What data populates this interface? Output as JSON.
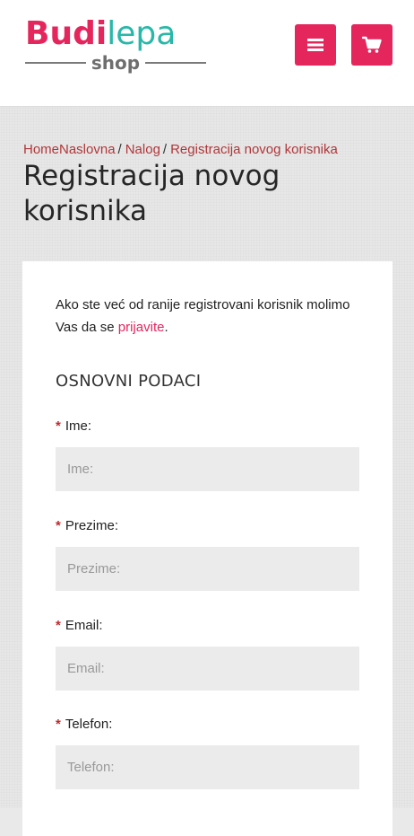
{
  "header": {
    "logo": {
      "part1": "Budi",
      "part2": "lepa",
      "sub": "shop"
    },
    "icons": {
      "menu": "hamburger-menu-icon",
      "cart": "shopping-cart-icon"
    },
    "colors": {
      "brand_pink": "#e5265d",
      "brand_teal": "#27b8a8",
      "logo_gray": "#6e6e6e"
    }
  },
  "breadcrumb": {
    "items": [
      "HomeNaslovna",
      "Nalog",
      "Registracija novog korisnika"
    ],
    "separator": "/"
  },
  "page": {
    "title": "Registracija novog korisnika"
  },
  "form": {
    "intro_text": "Ako ste već od ranije registrovani korisnik molimo Vas da se ",
    "intro_link": "prijavite",
    "intro_end": ".",
    "section_title": "OSNOVNI PODACI",
    "required_marker": "*",
    "fields": [
      {
        "label": "Ime:",
        "placeholder": "Ime:",
        "value": ""
      },
      {
        "label": "Prezime:",
        "placeholder": "Prezime:",
        "value": ""
      },
      {
        "label": "Email:",
        "placeholder": "Email:",
        "value": ""
      },
      {
        "label": "Telefon:",
        "placeholder": "Telefon:",
        "value": ""
      }
    ]
  }
}
